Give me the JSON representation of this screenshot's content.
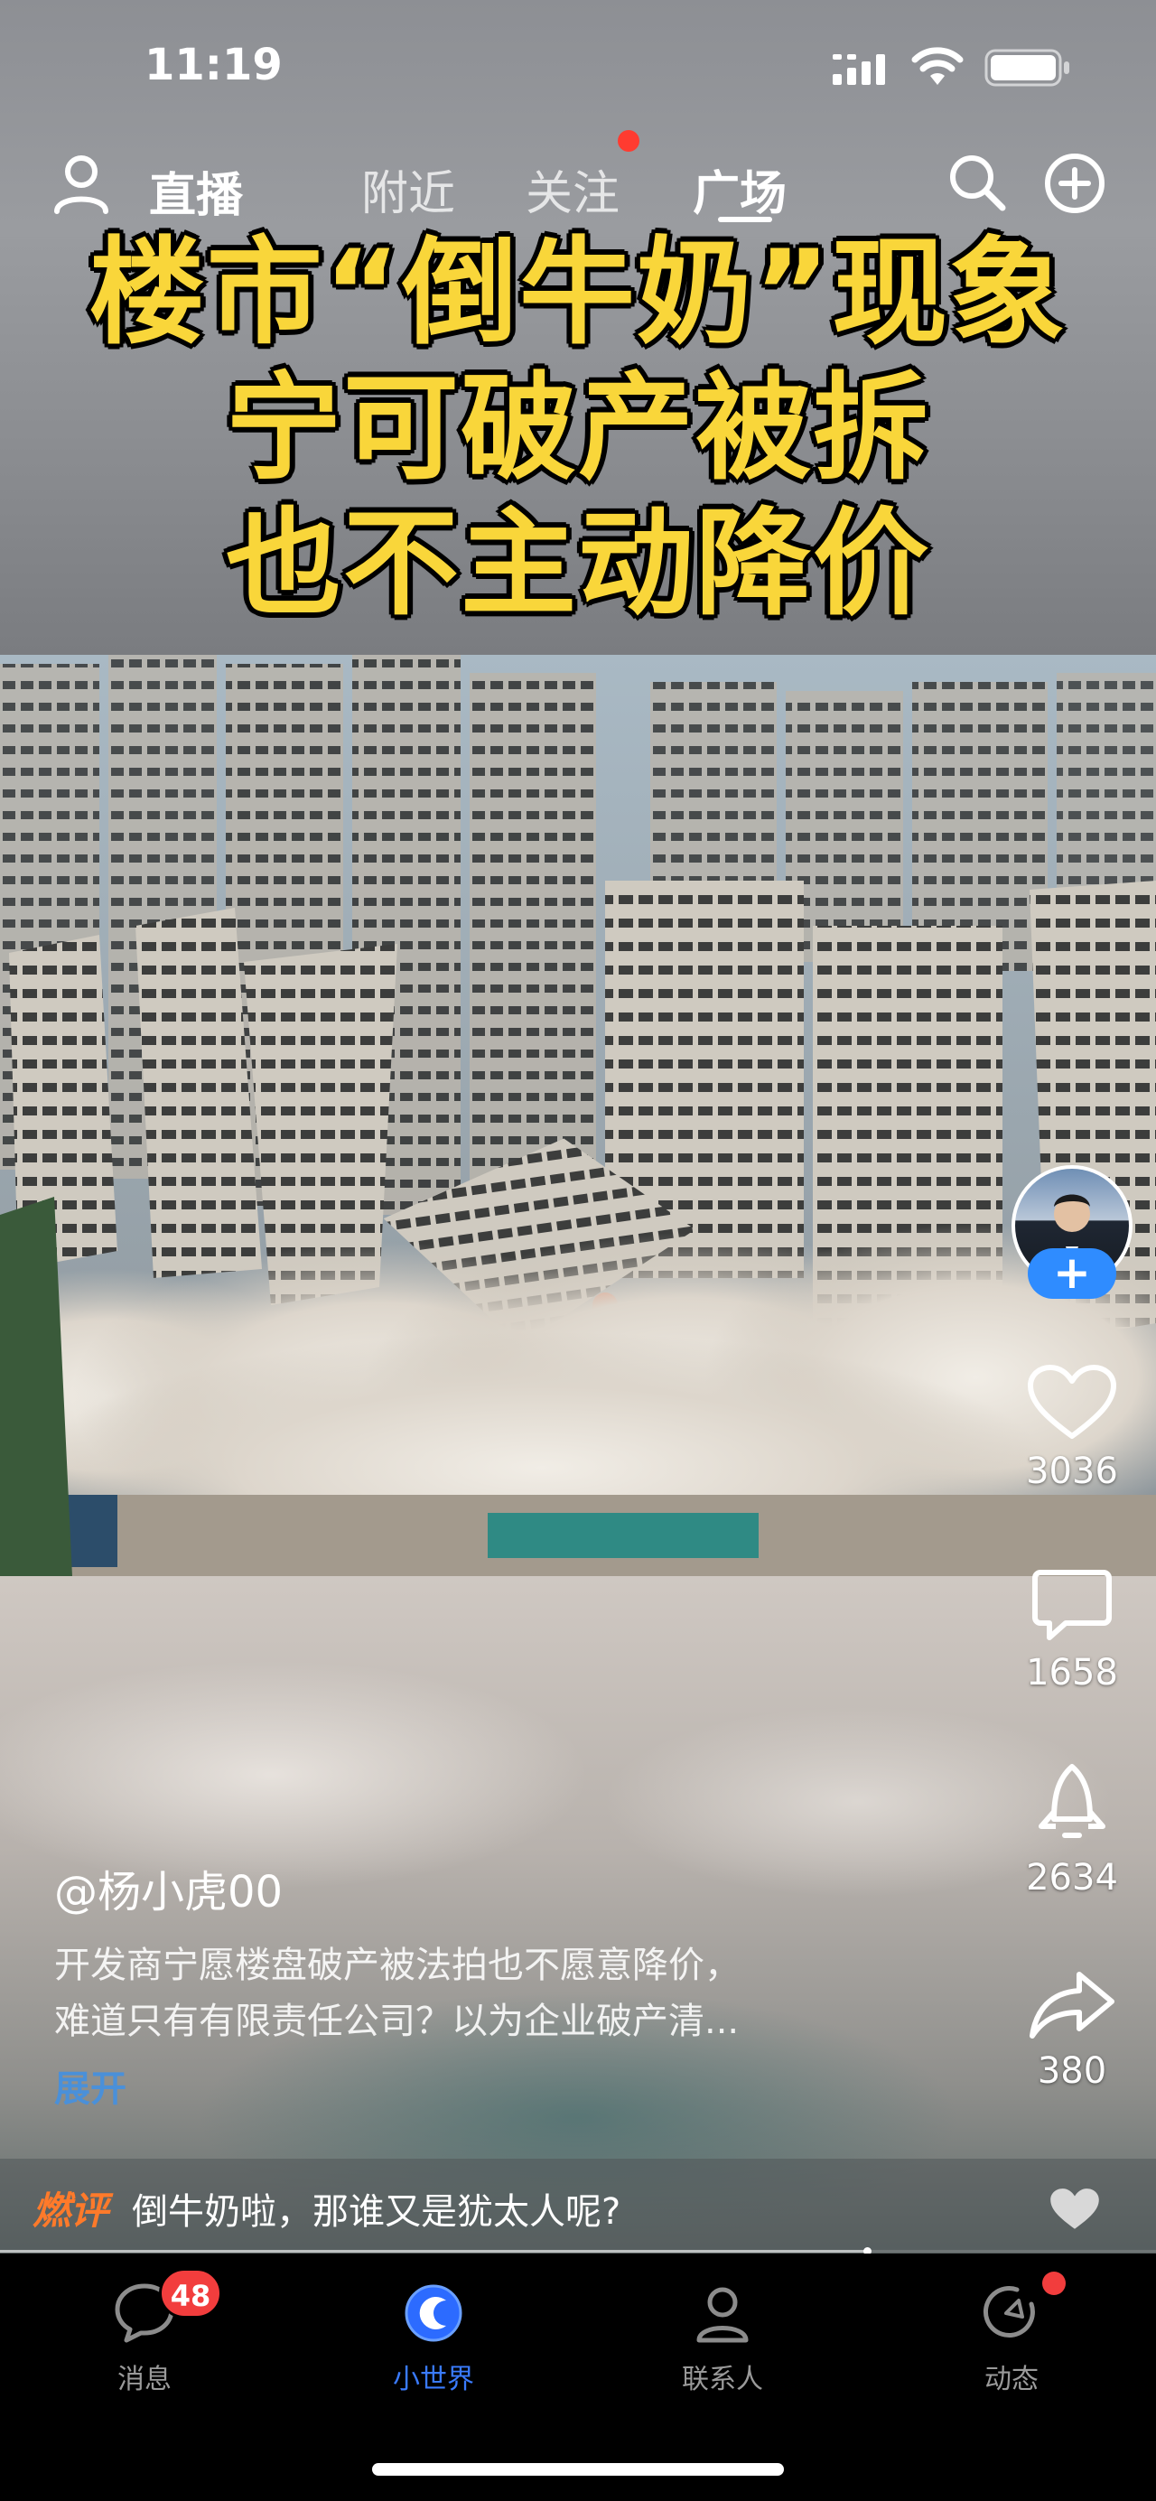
{
  "status_bar": {
    "time": "11:19"
  },
  "top_nav": {
    "live_label": "直播",
    "tabs": [
      {
        "label": "附近",
        "active": false
      },
      {
        "label": "关注",
        "active": false,
        "has_dot": true
      },
      {
        "label": "广场",
        "active": true
      }
    ]
  },
  "headline": {
    "lines": [
      "楼市“倒牛奶”现象",
      "宁可破产被拆",
      "也不主动降价"
    ],
    "color": "#f9d63a"
  },
  "actions": {
    "follow_plus": "+",
    "like_count": "3036",
    "comment_count": "1658",
    "reshare_count": "2634",
    "share_count": "380"
  },
  "post": {
    "author": "@杨小虎00",
    "desc_lines": [
      "开发商宁愿楼盘破产被法拍也不愿意降价，",
      "难道只有有限责任公司？以为企业破产清..."
    ],
    "expand": "展开"
  },
  "hot_comment": {
    "tag": "燃评",
    "text": "倒牛奶啦，那谁又是犹太人呢?"
  },
  "progress": {
    "fraction": 0.75
  },
  "tabbar": {
    "items": [
      {
        "label": "消息",
        "badge": "48",
        "icon": "chat-bubble-icon"
      },
      {
        "label": "小世界",
        "icon": "world-icon",
        "active": true
      },
      {
        "label": "联系人",
        "icon": "contacts-icon"
      },
      {
        "label": "动态",
        "icon": "moments-icon",
        "has_dot": true
      }
    ]
  },
  "colors": {
    "accent_blue": "#3a7bff",
    "badge_red": "#f23d3d",
    "hot_orange": "#ff7a2a"
  }
}
